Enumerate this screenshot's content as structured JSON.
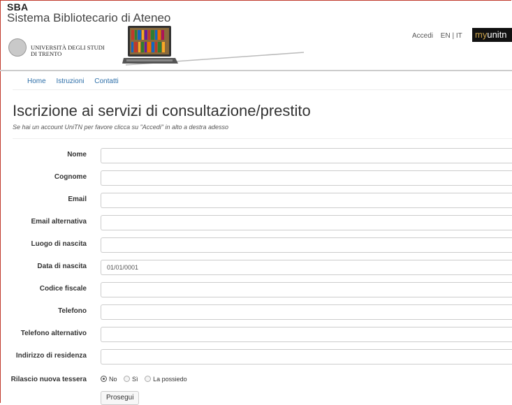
{
  "header": {
    "sba": "SBA",
    "system_name": "Sistema Bibliotecario di Ateneo",
    "university": "UNIVERSITÀ DEGLI STUDI",
    "university_city": "DI TRENTO",
    "login": "Accedi",
    "lang": "EN | IT",
    "portal_my": "my",
    "portal_unitn": "unitn"
  },
  "nav": {
    "home": "Home",
    "instructions": "Istruzioni",
    "contacts": "Contatti"
  },
  "page": {
    "title": "Iscrizione ai servizi di consultazione/prestito",
    "subtitle": "Se hai un account UniTN per favore clicca su \"Accedi\" in alto a destra adesso"
  },
  "form": {
    "fields": [
      {
        "label": "Nome",
        "value": ""
      },
      {
        "label": "Cognome",
        "value": ""
      },
      {
        "label": "Email",
        "value": ""
      },
      {
        "label": "Email alternativa",
        "value": ""
      },
      {
        "label": "Luogo di nascita",
        "value": ""
      },
      {
        "label": "Data di nascita",
        "value": "01/01/0001"
      },
      {
        "label": "Codice fiscale",
        "value": ""
      },
      {
        "label": "Telefono",
        "value": ""
      },
      {
        "label": "Telefono alternativo",
        "value": ""
      },
      {
        "label": "Indirizzo di residenza",
        "value": ""
      }
    ],
    "card_label": "Rilascio nuova tessera",
    "card_options": [
      "No",
      "Sì",
      "La possiedo"
    ],
    "card_selected": "No",
    "submit": "Prosegui"
  }
}
